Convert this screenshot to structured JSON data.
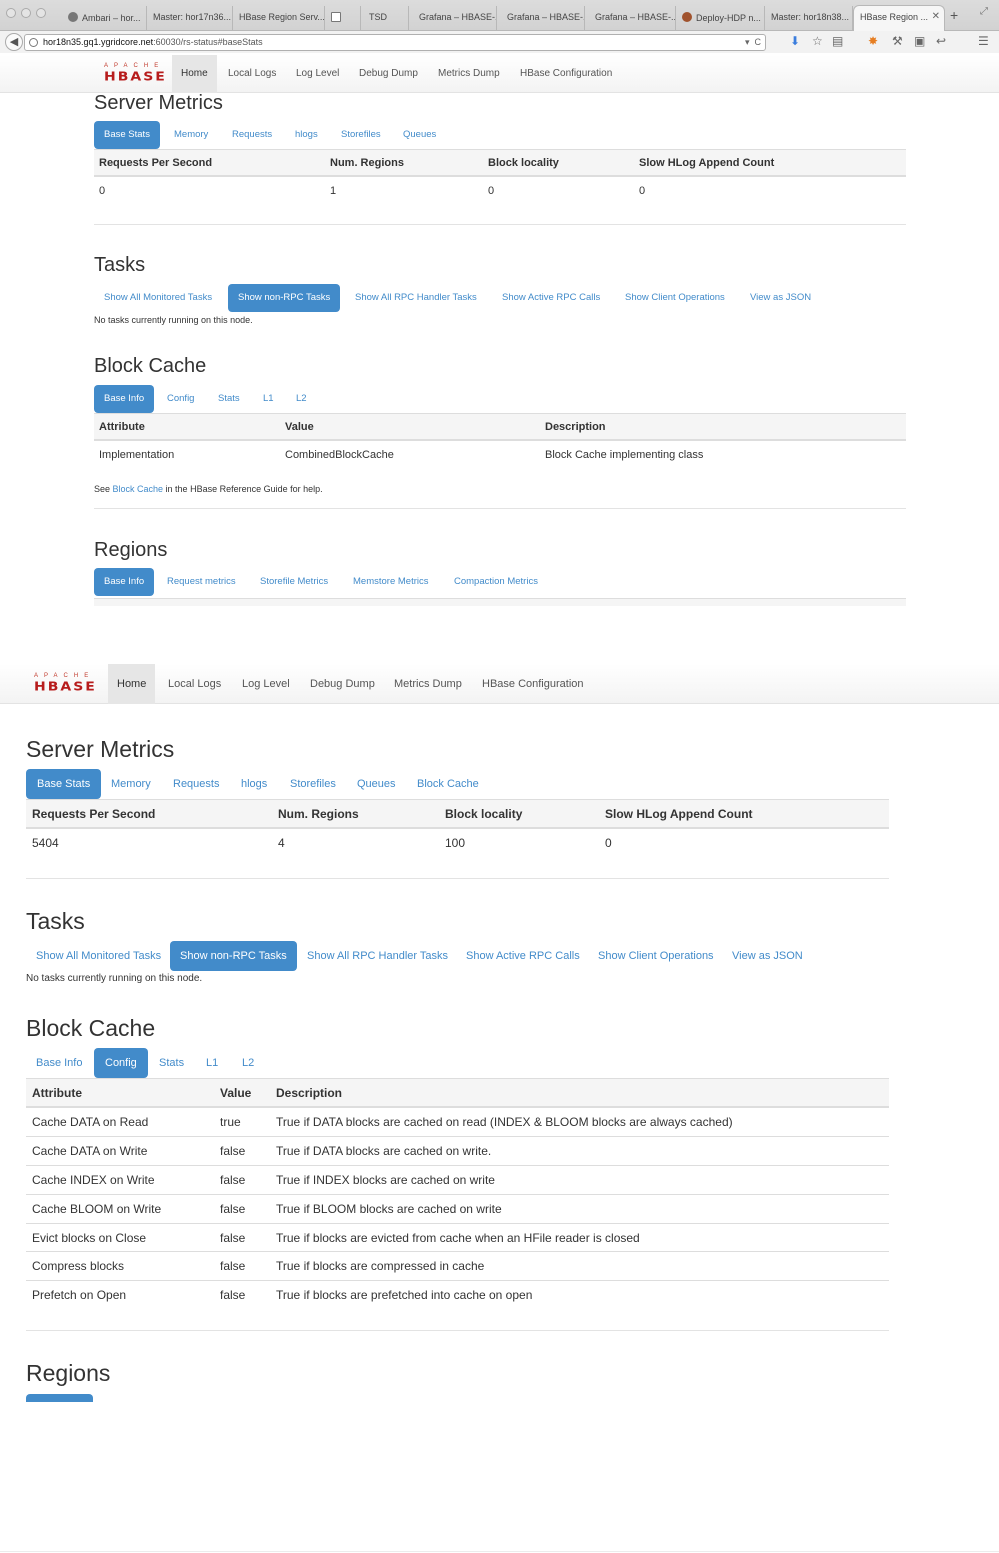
{
  "browser": {
    "tabs": [
      "Ambari – hor...",
      "Master: hor17n36...",
      "HBase Region Serv...",
      "",
      "TSD",
      "Grafana – HBASE-...",
      "Grafana – HBASE-...",
      "Grafana – HBASE-...",
      "Deploy-HDP n...",
      "Master: hor18n38...",
      "HBase Region ..."
    ],
    "url_host": "hor18n35.gq1.ygridcore.net",
    "url_rest": ":60030/rs-status#baseStats"
  },
  "logo": {
    "apache": "APACHE",
    "hbase": "HBASE"
  },
  "nav": [
    "Home",
    "Local Logs",
    "Log Level",
    "Debug Dump",
    "Metrics Dump",
    "HBase Configuration"
  ],
  "page1": {
    "server_metrics": {
      "title": "Server Metrics",
      "tabs": [
        "Base Stats",
        "Memory",
        "Requests",
        "hlogs",
        "Storefiles",
        "Queues"
      ],
      "headers": [
        "Requests Per Second",
        "Num. Regions",
        "Block locality",
        "Slow HLog Append Count"
      ],
      "row": [
        "0",
        "1",
        "0",
        "0"
      ]
    },
    "tasks": {
      "title": "Tasks",
      "tabs": [
        "Show All Monitored Tasks",
        "Show non-RPC Tasks",
        "Show All RPC Handler Tasks",
        "Show Active RPC Calls",
        "Show Client Operations",
        "View as JSON"
      ],
      "note": "No tasks currently running on this node."
    },
    "block_cache": {
      "title": "Block Cache",
      "tabs": [
        "Base Info",
        "Config",
        "Stats",
        "L1",
        "L2"
      ],
      "headers": [
        "Attribute",
        "Value",
        "Description"
      ],
      "row": [
        "Implementation",
        "CombinedBlockCache",
        "Block Cache implementing class"
      ],
      "help_prefix": "See ",
      "help_link": "Block Cache",
      "help_suffix": " in the HBase Reference Guide for help."
    },
    "regions": {
      "title": "Regions",
      "tabs": [
        "Base Info",
        "Request metrics",
        "Storefile Metrics",
        "Memstore Metrics",
        "Compaction Metrics"
      ]
    }
  },
  "page2": {
    "server_metrics": {
      "title": "Server Metrics",
      "tabs": [
        "Base Stats",
        "Memory",
        "Requests",
        "hlogs",
        "Storefiles",
        "Queues",
        "Block Cache"
      ],
      "headers": [
        "Requests Per Second",
        "Num. Regions",
        "Block locality",
        "Slow HLog Append Count"
      ],
      "row": [
        "5404",
        "4",
        "100",
        "0"
      ]
    },
    "tasks": {
      "title": "Tasks",
      "tabs": [
        "Show All Monitored Tasks",
        "Show non-RPC Tasks",
        "Show All RPC Handler Tasks",
        "Show Active RPC Calls",
        "Show Client Operations",
        "View as JSON"
      ],
      "note": "No tasks currently running on this node."
    },
    "block_cache": {
      "title": "Block Cache",
      "tabs": [
        "Base Info",
        "Config",
        "Stats",
        "L1",
        "L2"
      ],
      "headers": [
        "Attribute",
        "Value",
        "Description"
      ],
      "rows": [
        [
          "Cache DATA on Read",
          "true",
          "True if DATA blocks are cached on read (INDEX & BLOOM blocks are always cached)"
        ],
        [
          "Cache DATA on Write",
          "false",
          "True if DATA blocks are cached on write."
        ],
        [
          "Cache INDEX on Write",
          "false",
          "True if INDEX blocks are cached on write"
        ],
        [
          "Cache BLOOM on Write",
          "false",
          "True if BLOOM blocks are cached on write"
        ],
        [
          "Evict blocks on Close",
          "false",
          "True if blocks are evicted from cache when an HFile reader is closed"
        ],
        [
          "Compress blocks",
          "false",
          "True if blocks are compressed in cache"
        ],
        [
          "Prefetch on Open",
          "false",
          "True if blocks are prefetched into cache on open"
        ]
      ]
    },
    "regions": {
      "title": "Regions"
    }
  }
}
